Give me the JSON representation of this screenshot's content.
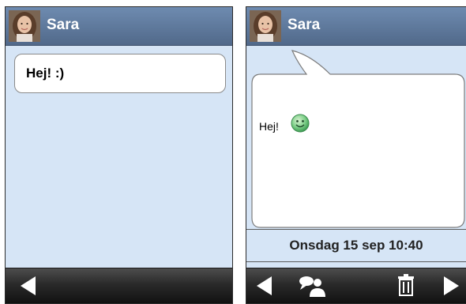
{
  "left_screen": {
    "contact": {
      "name": "Sara",
      "avatar_icon": "avatar-photo"
    },
    "message_draft": "Hej! :)",
    "footer": {
      "back_icon": "arrow-left-icon"
    }
  },
  "right_screen": {
    "contact": {
      "name": "Sara",
      "avatar_icon": "avatar-photo"
    },
    "message": {
      "text": "Hej!",
      "emoji_icon": "smiley-icon"
    },
    "timestamp": "Onsdag 15 sep 10:40",
    "footer": {
      "back_icon": "arrow-left-icon",
      "reply_icon": "chat-bubble-person-icon",
      "delete_icon": "trash-icon",
      "next_icon": "arrow-right-icon"
    }
  },
  "colors": {
    "header_blue": "#5f7ba0",
    "content_bg": "#d6e5f6",
    "footer_dark": "#2a2a2a"
  }
}
